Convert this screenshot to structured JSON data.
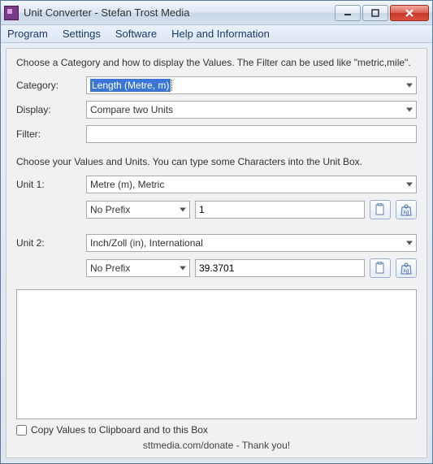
{
  "window": {
    "title": "Unit Converter - Stefan Trost Media"
  },
  "menu": {
    "program": "Program",
    "settings": "Settings",
    "software": "Software",
    "help": "Help and Information"
  },
  "top": {
    "hint": "Choose a Category and how to display the Values. The Filter can be used like \"metric,mile\".",
    "category_label": "Category:",
    "category_value": "Length (Metre, m)",
    "display_label": "Display:",
    "display_value": "Compare two Units",
    "filter_label": "Filter:",
    "filter_value": ""
  },
  "mid": {
    "hint": "Choose your Values and Units. You can type some Characters into the Unit Box."
  },
  "unit1": {
    "label": "Unit 1:",
    "unit": "Metre (m), Metric",
    "prefix": "No Prefix",
    "value": "1"
  },
  "unit2": {
    "label": "Unit 2:",
    "unit": "Inch/Zoll (in), International",
    "prefix": "No Prefix",
    "value": "39.3701"
  },
  "footer": {
    "copy_label": "Copy Values to Clipboard and to this Box",
    "donate": "sttmedia.com/donate - Thank you!"
  }
}
